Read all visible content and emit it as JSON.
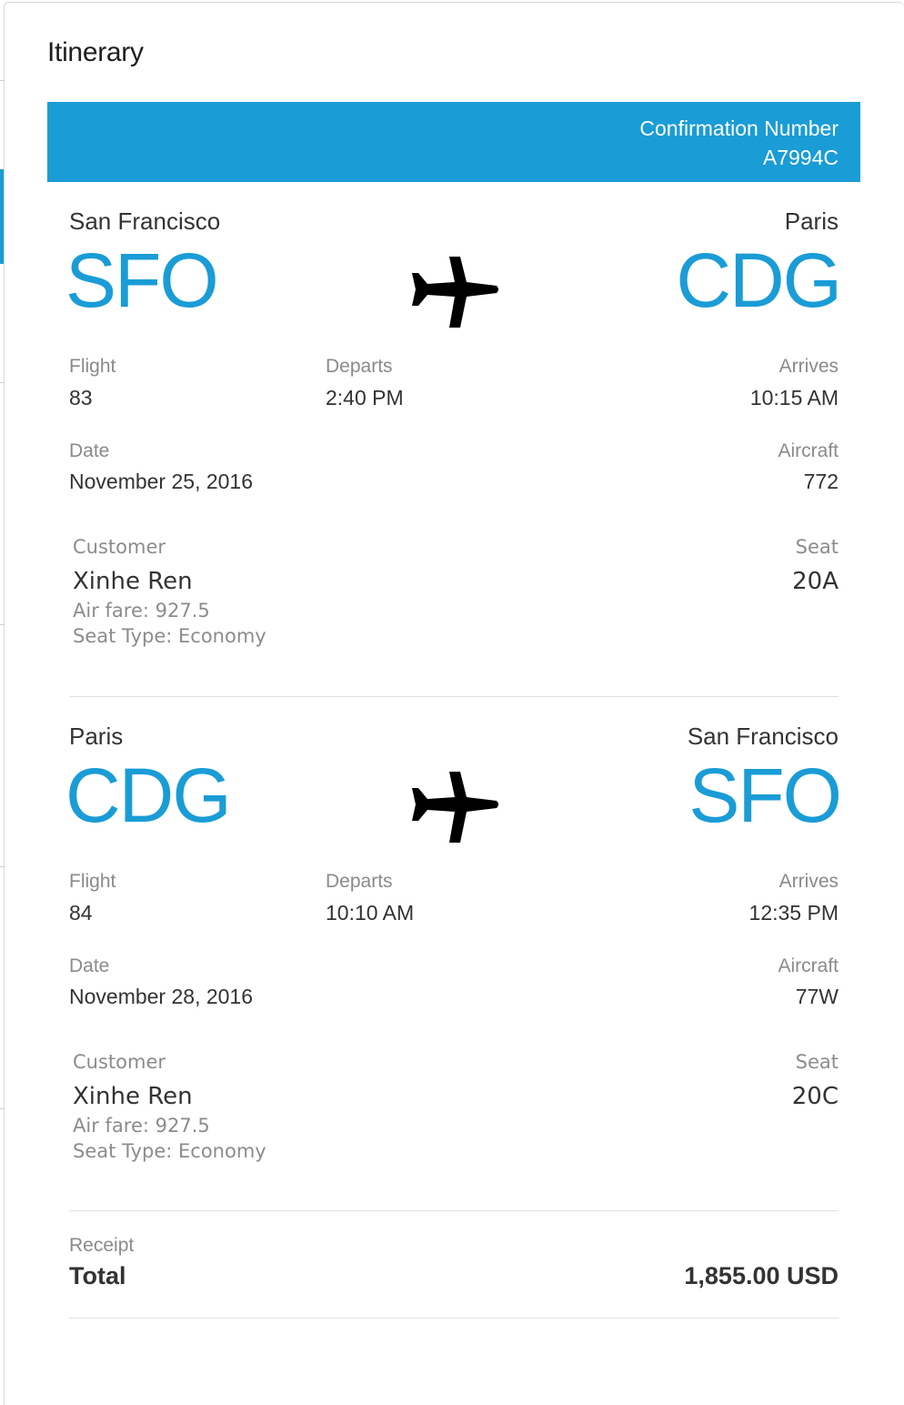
{
  "modal": {
    "title": "Itinerary"
  },
  "confirmation": {
    "label": "Confirmation Number",
    "number": "A7994C"
  },
  "flights": [
    {
      "origin_city": "San Francisco",
      "origin_code": "SFO",
      "destination_city": "Paris",
      "destination_code": "CDG",
      "plane_icon": "airplane-icon",
      "flight_label": "Flight",
      "flight_number": "83",
      "departs_label": "Departs",
      "departs_time": "2:40 PM",
      "arrives_label": "Arrives",
      "arrives_time": "10:15 AM",
      "date_label": "Date",
      "date": "November 25, 2016",
      "aircraft_label": "Aircraft",
      "aircraft": "772",
      "customer_label": "Customer",
      "customer_name": "Xinhe Ren",
      "air_fare": "Air fare: 927.5",
      "seat_type": "Seat Type: Economy",
      "seat_label": "Seat",
      "seat": "20A"
    },
    {
      "origin_city": "Paris",
      "origin_code": "CDG",
      "destination_city": "San Francisco",
      "destination_code": "SFO",
      "plane_icon": "airplane-icon",
      "flight_label": "Flight",
      "flight_number": "84",
      "departs_label": "Departs",
      "departs_time": "10:10 AM",
      "arrives_label": "Arrives",
      "arrives_time": "12:35 PM",
      "date_label": "Date",
      "date": "November 28, 2016",
      "aircraft_label": "Aircraft",
      "aircraft": "77W",
      "customer_label": "Customer",
      "customer_name": "Xinhe Ren",
      "air_fare": "Air fare: 927.5",
      "seat_type": "Seat Type: Economy",
      "seat_label": "Seat",
      "seat": "20C"
    }
  ],
  "receipt": {
    "label": "Receipt",
    "total_label": "Total",
    "total_value": "1,855.00 USD"
  },
  "colors": {
    "accent": "#1a9cd6",
    "text": "#333333",
    "muted": "#8a8a8a"
  }
}
